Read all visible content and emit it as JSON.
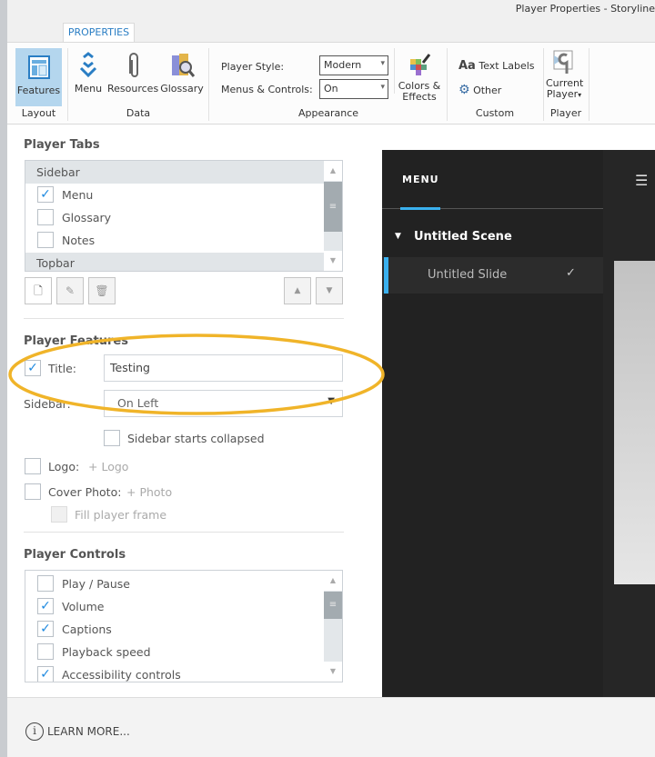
{
  "window": {
    "title": "Player Properties - Storyline"
  },
  "tab": "PROPERTIES",
  "ribbon": {
    "features": "Features",
    "layout_group": "Layout",
    "menu": "Menu",
    "resources": "Resources",
    "glossary": "Glossary",
    "data_group": "Data",
    "player_style_label": "Player Style:",
    "player_style_value": "Modern",
    "menus_controls_label": "Menus & Controls:",
    "menus_controls_value": "On",
    "colors_effects": "Colors & Effects",
    "appearance_group": "Appearance",
    "text_labels": "Text Labels",
    "text_labels_icon": "Aa",
    "other": "Other",
    "custom_group": "Custom",
    "current_player": "Current Player",
    "player_group": "Player"
  },
  "player_tabs": {
    "heading": "Player Tabs",
    "groups": [
      {
        "label": "Sidebar",
        "items": [
          {
            "label": "Menu",
            "checked": true
          },
          {
            "label": "Glossary",
            "checked": false
          },
          {
            "label": "Notes",
            "checked": false
          }
        ]
      },
      {
        "label": "Topbar"
      }
    ]
  },
  "player_features": {
    "heading": "Player Features",
    "title_label": "Title:",
    "title_checked": true,
    "title_value": "Testing",
    "sidebar_label": "Sidebar:",
    "sidebar_value": "On Left",
    "sidebar_collapsed": "Sidebar starts collapsed",
    "logo_label": "Logo:",
    "logo_add": "+ Logo",
    "cover_label": "Cover Photo:",
    "cover_add": "+ Photo",
    "fill_frame": "Fill player frame"
  },
  "player_controls": {
    "heading": "Player Controls",
    "items": [
      {
        "label": "Play / Pause",
        "checked": false
      },
      {
        "label": "Volume",
        "checked": true
      },
      {
        "label": "Captions",
        "checked": true
      },
      {
        "label": "Playback speed",
        "checked": false
      },
      {
        "label": "Accessibility controls",
        "checked": true
      }
    ]
  },
  "preview": {
    "menu_tab": "MENU",
    "scene": "Untitled Scene",
    "slide": "Untitled Slide"
  },
  "footer": {
    "learn_more": "LEARN MORE..."
  },
  "colors": {
    "accent": "#1f8ae0",
    "highlight": "#f0b429",
    "preview_bg": "#222222"
  }
}
